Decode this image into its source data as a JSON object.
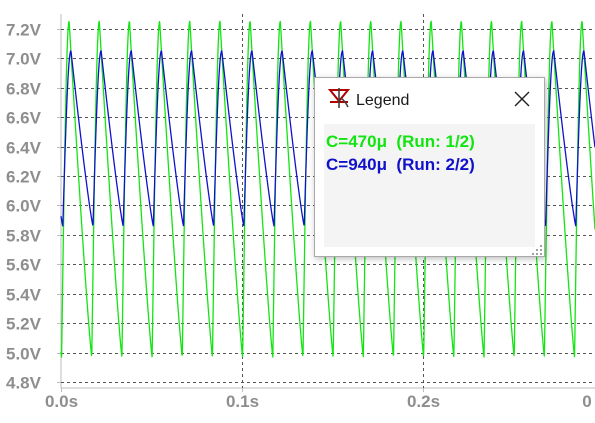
{
  "colors": {
    "background": "#ffffff",
    "grid": "#555555",
    "tick_text": "#8e8e8e",
    "axis_line": "#bdbdbd"
  },
  "chart_data": {
    "type": "line",
    "title": "",
    "xlabel": "",
    "ylabel": "",
    "x_tick_labels": [
      "0.0s",
      "0.1s",
      "0.2s",
      "0"
    ],
    "x_tick_values": [
      0.0,
      0.1,
      0.2,
      0.3
    ],
    "xlim": [
      0.0,
      0.295
    ],
    "y_tick_labels": [
      "4.8V",
      "5.0V",
      "5.2V",
      "5.4V",
      "5.6V",
      "5.8V",
      "6.0V",
      "6.2V",
      "6.4V",
      "6.6V",
      "6.8V",
      "7.0V",
      "7.2V"
    ],
    "y_tick_values": [
      4.8,
      5.0,
      5.2,
      5.4,
      5.6,
      5.8,
      6.0,
      6.2,
      6.4,
      6.6,
      6.8,
      7.0,
      7.2
    ],
    "ylim": [
      4.76,
      7.3
    ],
    "grid": true,
    "series": [
      {
        "name": "C=470μ  (Run: 1/2)",
        "color": "#12e512",
        "waveform": "sawtooth",
        "period_s": 0.01667,
        "first_peak_s": 0.0045,
        "rise_fraction": 0.25,
        "max_v": 7.25,
        "min_v": 4.97
      },
      {
        "name": "C=940μ  (Run: 2/2)",
        "color": "#1111cc",
        "waveform": "sawtooth",
        "period_s": 0.01667,
        "first_peak_s": 0.0055,
        "rise_fraction": 0.27,
        "max_v": 7.05,
        "min_v": 5.86
      }
    ]
  },
  "legend": {
    "title": "Legend",
    "entries": [
      {
        "label": "C=470μ  (Run: 1/2)",
        "color": "#12e512"
      },
      {
        "label": "C=940μ  (Run: 2/2)",
        "color": "#1111cc"
      }
    ],
    "icons": {
      "app": "ltspice-diode-icon",
      "close": "close-icon",
      "resize": "resize-grip-icon"
    }
  }
}
